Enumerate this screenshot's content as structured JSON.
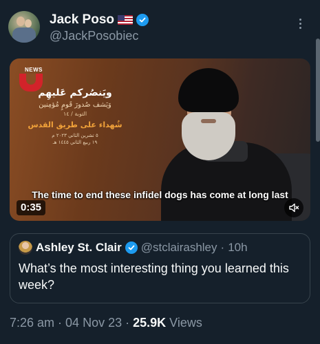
{
  "author": {
    "display_name": "Jack Poso",
    "flag_emoji_icon": "us-flag-icon",
    "handle": "@JackPosobiec",
    "verified": true
  },
  "video": {
    "channel_logo_text": "NEWS",
    "overlay_arabic": {
      "line1": "ويَنصُركم عَليهِم",
      "line2": "وَيَشف صُدورَ قَومٍ مُؤمِنين",
      "line3": "التوبة / ١٤",
      "line4": "شُهداء على طريق القدس",
      "line5": "٥ تشرين الثاني ٢٠٢٣ م",
      "line6": "١٩ ربيع الثاني ١٤٤٥ هـ"
    },
    "caption": "The time to end these infidel dogs has come at long last",
    "duration": "0:35",
    "muted": true
  },
  "quoted_post": {
    "display_name": "Ashley St. Clair",
    "verified": true,
    "handle": "@stclairashley",
    "separator": "·",
    "time": "10h",
    "text": "What’s the most interesting thing you learned this week?"
  },
  "meta": {
    "time": "7:26 am",
    "sep1": "·",
    "date": "04 Nov 23",
    "sep2": "·",
    "views_count": "25.9K",
    "views_label": "Views"
  },
  "colors": {
    "background": "#15202b",
    "primary_text": "#f7f9f9",
    "secondary_text": "#8b98a5",
    "verified_blue": "#1d9bf0",
    "border": "#38444d"
  }
}
